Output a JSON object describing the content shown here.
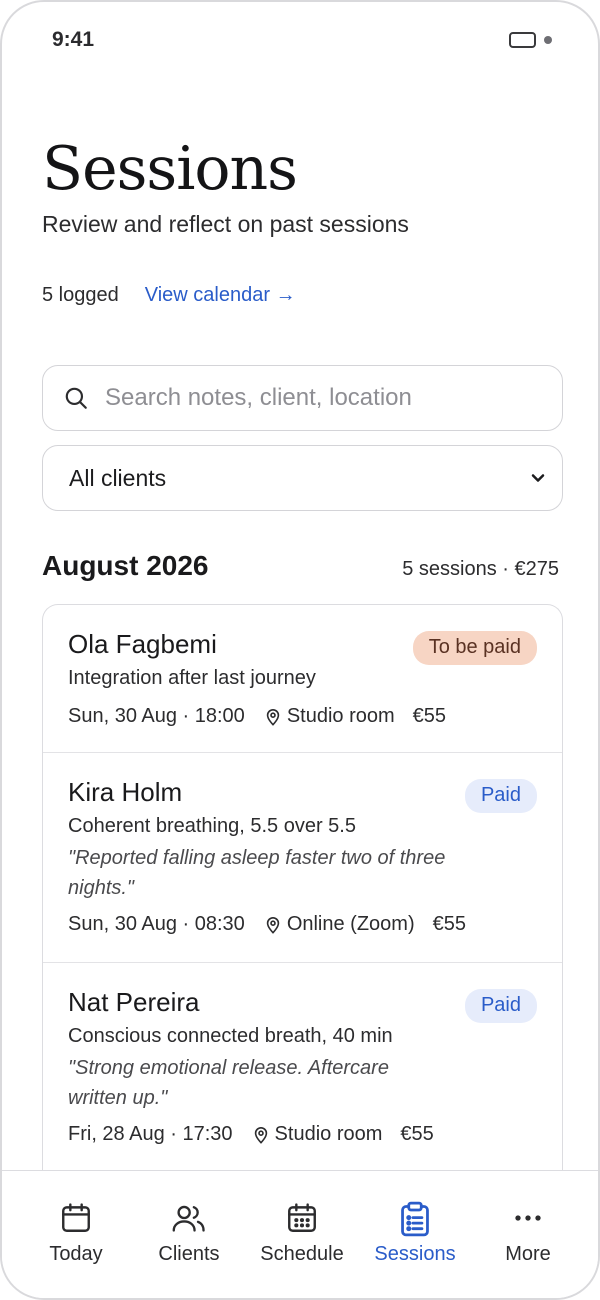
{
  "status": {
    "time": "9:41"
  },
  "header": {
    "title": "Sessions",
    "subtitle": "Review and reflect on past sessions",
    "count": "5 logged",
    "view_calendar": "View calendar →"
  },
  "search": {
    "placeholder": "Search notes, client, location",
    "value": ""
  },
  "filter": {
    "selected": "All clients"
  },
  "month": {
    "heading": "August 2026",
    "summary": "5 sessions · €275"
  },
  "sessions": [
    {
      "client": "Ola Fagbemi",
      "status": "To be paid",
      "type": "Integration after last journey",
      "note": "",
      "when": "Sun, 30 Aug · 18:00",
      "location": "Studio room",
      "price": "€55"
    },
    {
      "client": "Kira Holm",
      "status": "Paid",
      "type": "Coherent breathing, 5.5 over 5.5",
      "note": "\"Reported falling asleep faster two of three nights.\"",
      "when": "Sun, 30 Aug · 08:30",
      "location": "Online (Zoom)",
      "price": "€55"
    },
    {
      "client": "Nat Pereira",
      "status": "Paid",
      "type": "Conscious connected breath, 40 min",
      "note": "\"Strong emotional release. Aftercare written up.\"",
      "when": "Fri, 28 Aug · 17:30",
      "location": "Studio room",
      "price": "€55"
    }
  ],
  "tabs": [
    {
      "label": "Today",
      "icon": "calendar-icon"
    },
    {
      "label": "Clients",
      "icon": "users-icon"
    },
    {
      "label": "Schedule",
      "icon": "calendar-grid-icon"
    },
    {
      "label": "Sessions",
      "icon": "clipboard-list-icon",
      "active": true
    },
    {
      "label": "More",
      "icon": "more-dots-icon"
    }
  ],
  "colors": {
    "accent": "#2a5cc9",
    "unpaid_badge": "#f7d5c4",
    "paid_badge": "#e6ecfb"
  }
}
